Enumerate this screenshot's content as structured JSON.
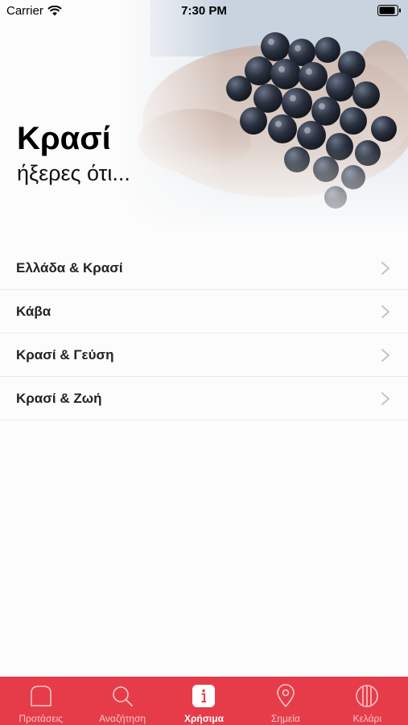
{
  "status_bar": {
    "carrier": "Carrier",
    "time": "7:30 PM"
  },
  "hero": {
    "title": "Κρασί",
    "subtitle": "ήξερες ότι..."
  },
  "menu": {
    "items": [
      {
        "label": "Ελλάδα & Κρασί"
      },
      {
        "label": "Κάβα"
      },
      {
        "label": "Κρασί & Γεύση"
      },
      {
        "label": "Κρασί & Ζωή"
      }
    ]
  },
  "tab_bar": {
    "tabs": [
      {
        "label": "Προτάσεις",
        "icon": "home-icon"
      },
      {
        "label": "Αναζήτηση",
        "icon": "search-icon"
      },
      {
        "label": "Χρήσιμα",
        "icon": "info-icon",
        "active": true
      },
      {
        "label": "Σημεία",
        "icon": "location-pin-icon"
      },
      {
        "label": "Κελάρι",
        "icon": "barrel-icon"
      }
    ]
  },
  "colors": {
    "accent": "#e63c49",
    "background": "#fcfcfc",
    "grape": "#2a3140"
  }
}
